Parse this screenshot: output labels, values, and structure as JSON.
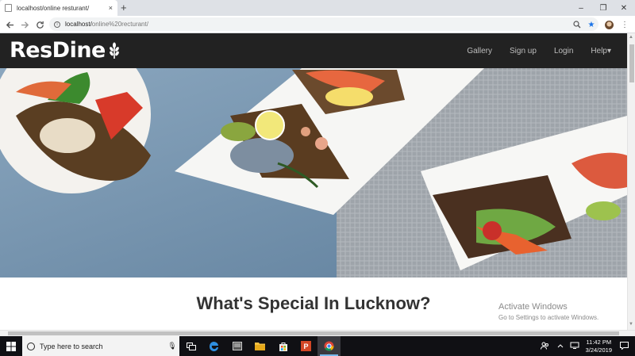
{
  "browser": {
    "tab_title": "localhost/online resturant/",
    "tab_close": "×",
    "new_tab": "+",
    "url_host": "localhost/",
    "url_path": "online%20recturant/",
    "back_icon": "arrow-left-icon",
    "forward_icon": "arrow-right-icon",
    "reload_icon": "reload-icon",
    "window_minimize": "–",
    "window_restore": "❐",
    "window_close": "✕",
    "menu_glyph": "⋮"
  },
  "site": {
    "brand": "ResDine",
    "nav": {
      "gallery": "Gallery",
      "signup": "Sign up",
      "login": "Login",
      "help": "Help▾"
    },
    "section_title": "What's Special In Lucknow?"
  },
  "watermark": {
    "line1": "Activate Windows",
    "line2": "Go to Settings to activate Windows."
  },
  "taskbar": {
    "search_placeholder": "Type here to search",
    "time": "11:42 PM",
    "date": "3/24/2019"
  },
  "colors": {
    "navbar": "#222222",
    "taskbar": "#101014",
    "accent_blue": "#1a73e8",
    "hero_blue": "#7f9bb3"
  }
}
